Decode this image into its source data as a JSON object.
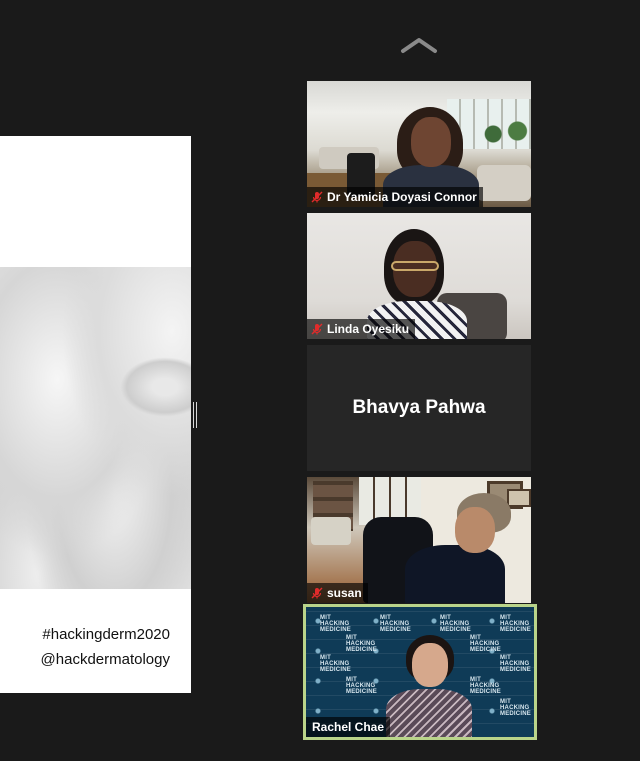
{
  "toolbar": {
    "collapse_icon": "chevron-up-icon"
  },
  "share": {
    "hashtag": "#hackingderm2020",
    "handle": "@hackdermatology"
  },
  "participants": [
    {
      "name": "Dr Yamicia Doyasi Connor",
      "muted": true,
      "video": true
    },
    {
      "name": "Linda Oyesiku",
      "muted": true,
      "video": true
    },
    {
      "name": "Bhavya Pahwa",
      "muted": false,
      "video": false
    },
    {
      "name": "susan",
      "muted": true,
      "video": true
    },
    {
      "name": "Rachel Chae",
      "muted": false,
      "video": true,
      "active_speaker": true
    }
  ],
  "backdrop_logo": {
    "line1": "MIT",
    "line2": "HACKING",
    "line3": "MEDICINE"
  },
  "colors": {
    "background": "#1a1a1a",
    "active_speaker_border": "#b9d48a",
    "mute_icon": "#e02b2b"
  }
}
